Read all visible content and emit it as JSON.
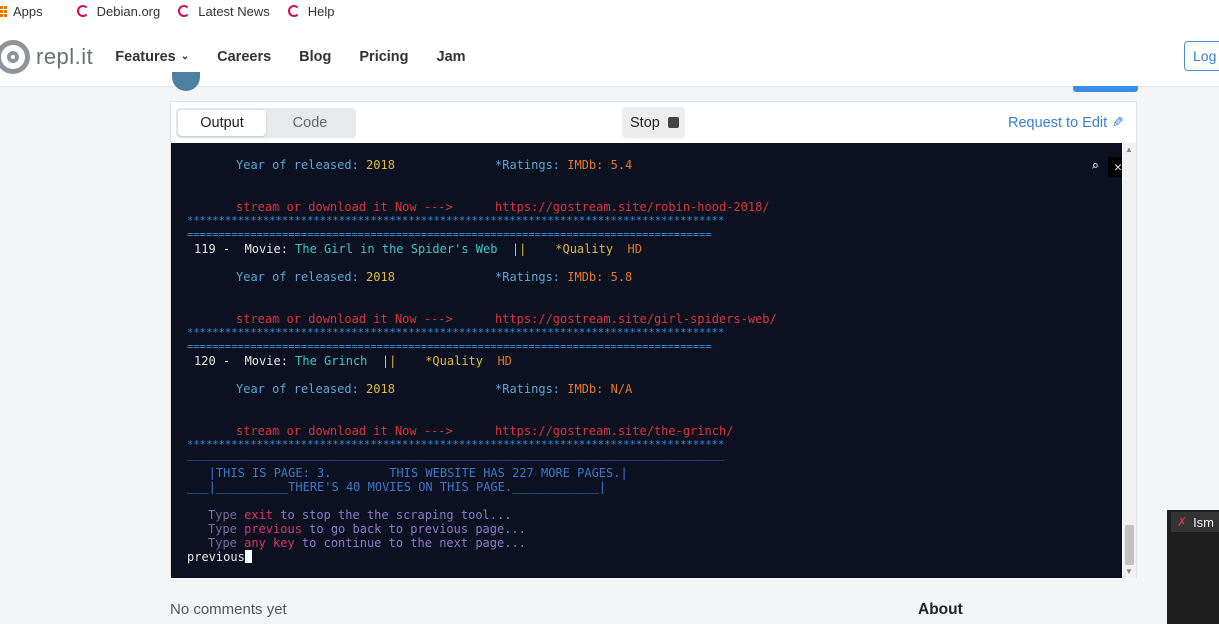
{
  "bookmarks": [
    {
      "label": "Apps",
      "icon": "apps-grid-icon"
    },
    {
      "label": "Debian.org",
      "icon": "debian-icon"
    },
    {
      "label": "Latest News",
      "icon": "debian-icon"
    },
    {
      "label": "Help",
      "icon": "debian-icon"
    }
  ],
  "header": {
    "logo_text": "repl.it",
    "nav": [
      "Features",
      "Careers",
      "Blog",
      "Pricing",
      "Jam"
    ],
    "login_label": "Log"
  },
  "repl": {
    "tabs": [
      "Output",
      "Code"
    ],
    "active_tab": "Output",
    "stop_label": "Stop",
    "request_edit_label": "Request to Edit"
  },
  "terminal": {
    "entry_118": {
      "year_label": "Year of released: ",
      "year": "2018",
      "ratings_label": "*Ratings: ",
      "ratings_value": "IMDb: 5.4",
      "stream_label": "stream or download it Now --->",
      "url": "https://gostream.site/robin-hood-2018/"
    },
    "entry_119": {
      "num": "119 -  Movie: ",
      "title": "The Girl in the Spider's Web",
      "sep": "  ||    *Quality  ",
      "quality": "HD",
      "year_label": "Year of released: ",
      "year": "2018",
      "ratings_label": "*Ratings: ",
      "ratings_value": "IMDb: 5.8",
      "stream_label": "stream or download it Now --->",
      "url": "https://gostream.site/girl-spiders-web/"
    },
    "entry_120": {
      "num": "120 -  Movie: ",
      "title": "The Grinch",
      "sep": "  ||    *Quality  ",
      "quality": "HD",
      "year_label": "Year of released: ",
      "year": "2018",
      "ratings_label": "*Ratings: ",
      "ratings_value": "IMDb: N/A",
      "stream_label": "stream or download it Now --->",
      "url": "https://gostream.site/the-grinch/"
    },
    "stars": "*************************************************************************************",
    "equals": "===================================================================================",
    "underline": "_____________________________________________________________________________________",
    "page_box_line1": "   |THIS IS PAGE: 3.        THIS WEBSITE HAS 227 MORE PAGES.|",
    "page_box_line2": "___|__________THERE'S 40 MOVIES ON THIS PAGE.____________|",
    "help_type": "Type ",
    "help_exit_kw": "exit",
    "help_exit_rest": " to stop the the scraping tool...",
    "help_prev_kw": "previous",
    "help_prev_rest": " to go back to previous page...",
    "help_any_kw": "any key",
    "help_any_rest": " to continue to the next page...",
    "input_text": "previous"
  },
  "footer": {
    "no_comments": "No comments yet",
    "about": "About"
  },
  "video_tile": {
    "name": "Ism"
  }
}
